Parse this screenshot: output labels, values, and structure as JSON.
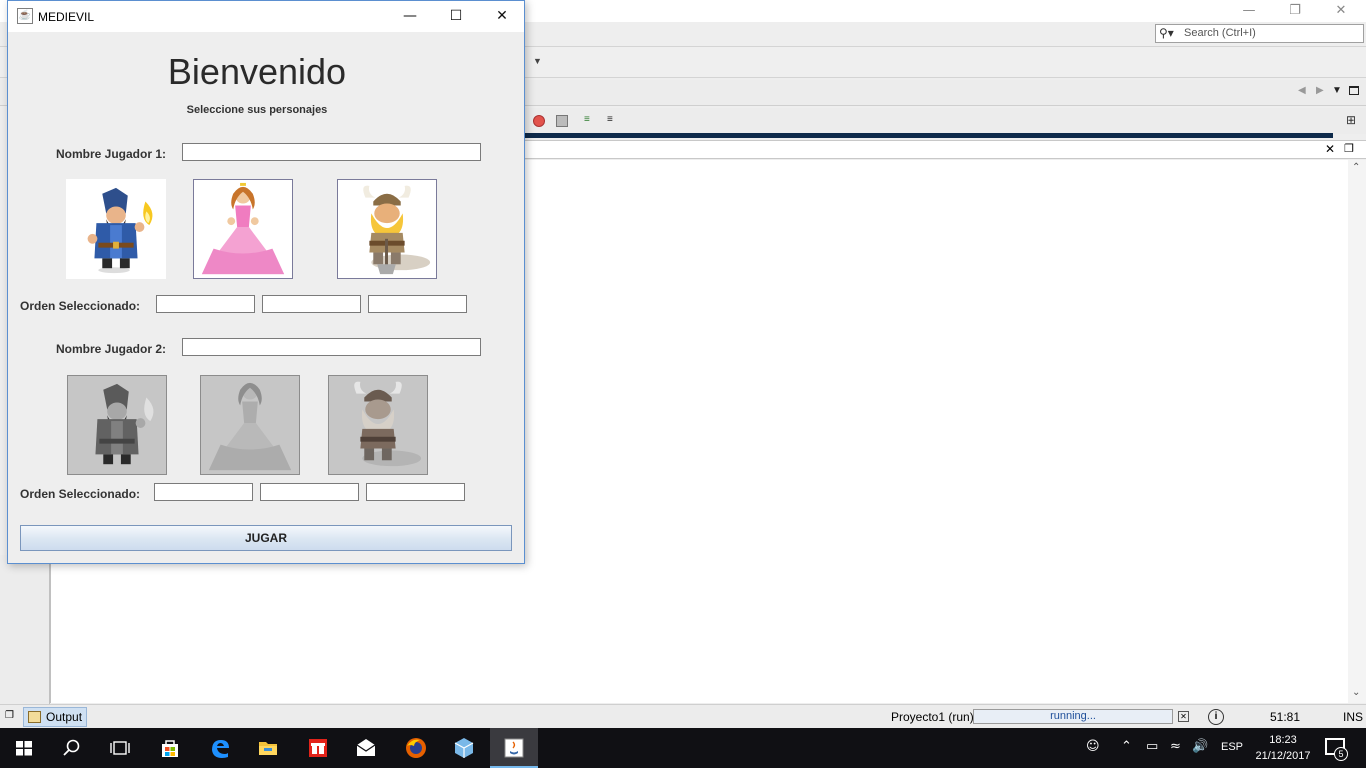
{
  "dialog": {
    "title": "MEDIEVIL",
    "heading": "Bienvenido",
    "subheading": "Seleccione sus personajes",
    "player1": {
      "name_label": "Nombre Jugador 1:",
      "name_value": "",
      "order_label": "Orden Seleccionado:",
      "order_values": [
        "",
        "",
        ""
      ],
      "characters": [
        {
          "name": "wizard",
          "state": "enabled"
        },
        {
          "name": "princess",
          "state": "enabled"
        },
        {
          "name": "viking",
          "state": "enabled"
        }
      ]
    },
    "player2": {
      "name_label": "Nombre Jugador 2:",
      "name_value": "",
      "order_label": "Orden Seleccionado:",
      "order_values": [
        "",
        "",
        ""
      ],
      "characters": [
        {
          "name": "wizard",
          "state": "disabled"
        },
        {
          "name": "princess",
          "state": "disabled"
        },
        {
          "name": "viking",
          "state": "disabled"
        }
      ]
    },
    "play_button": "JUGAR"
  },
  "ide": {
    "search_placeholder": "Search (Ctrl+I)",
    "output_tab": "Output",
    "status": {
      "project": "Proyecto1 (run)",
      "run_state": "running...",
      "caret_position": "51:81",
      "insert_mode": "INS"
    }
  },
  "taskbar": {
    "language": "ESP",
    "time": "18:23",
    "date": "21/12/2017",
    "notifications": "5",
    "apps": [
      "start",
      "search",
      "task-view",
      "store",
      "edge",
      "file-explorer",
      "gift-app",
      "mail",
      "firefox",
      "virtualbox",
      "java"
    ]
  },
  "colors": {
    "dialog_border": "#5b8fd0",
    "taskbar": "#101014",
    "running_bar": "#0e2a4a",
    "princess_dress": "#f4a2d2"
  }
}
